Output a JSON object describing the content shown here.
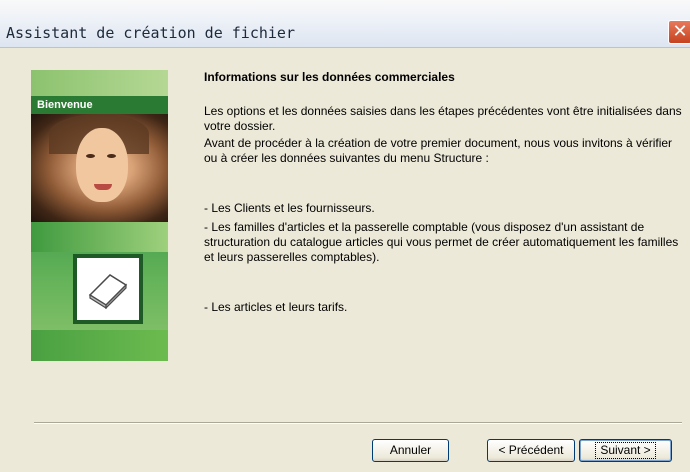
{
  "window": {
    "title": "Assistant de création de fichier",
    "close_glyph": "✕"
  },
  "banner": {
    "welcome": "Bienvenue",
    "icon": "document-icon"
  },
  "main": {
    "heading": "Informations sur les données commerciales",
    "paragraphs": [
      "Les options et les données saisies dans les étapes précédentes vont être initialisées dans votre dossier.",
      "Avant de procéder à la création de votre premier document, nous vous invitons à vérifier ou à créer les données suivantes du menu Structure :",
      "- Les Clients et les fournisseurs.",
      "- Les familles d'articles et la passerelle comptable (vous disposez d'un assistant de structuration du catalogue articles qui vous permet de créer automatiquement les familles et leurs passerelles comptables).",
      "- Les articles et leurs tarifs."
    ]
  },
  "buttons": {
    "cancel": "Annuler",
    "previous": "< Précédent",
    "next": "Suivant >"
  },
  "colors": {
    "window_bg": "#ece9d8",
    "banner_green": "#2b7a33",
    "close_red": "#c5431f"
  }
}
